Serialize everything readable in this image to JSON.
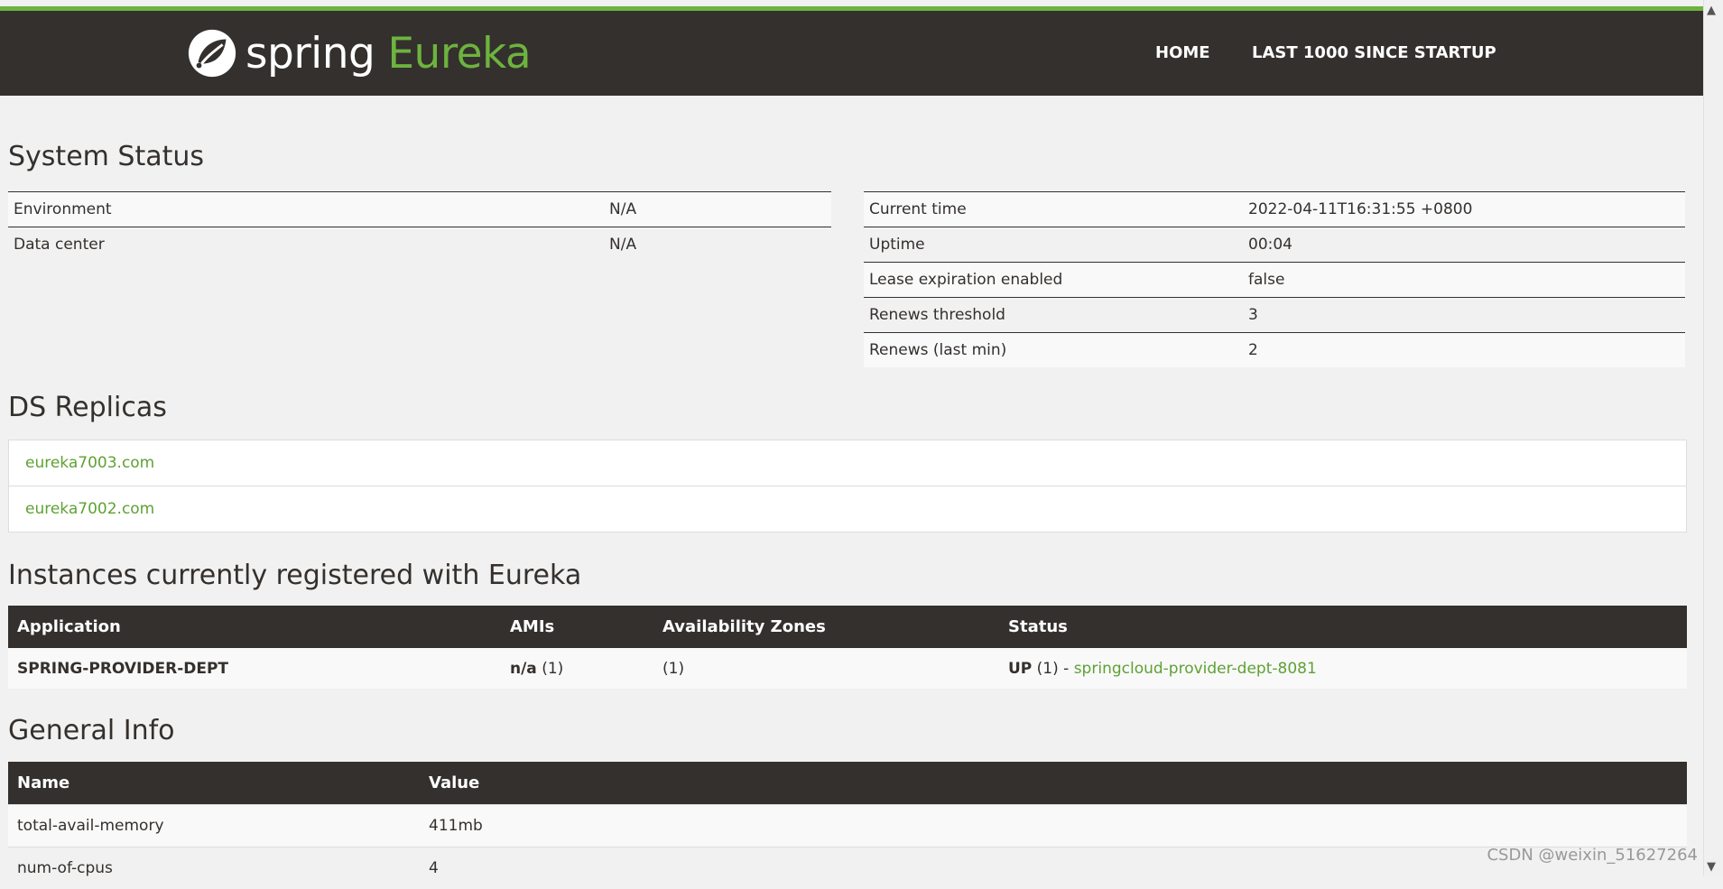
{
  "nav": {
    "brand_spring": "spring",
    "brand_eureka": "Eureka",
    "home": "HOME",
    "last1000": "LAST 1000 SINCE STARTUP"
  },
  "colors": {
    "accent": "#6db33f",
    "dark": "#34302d",
    "link": "#5fa134"
  },
  "system_status": {
    "title": "System Status",
    "left": [
      {
        "key": "Environment",
        "value": "N/A"
      },
      {
        "key": "Data center",
        "value": "N/A"
      }
    ],
    "right": [
      {
        "key": "Current time",
        "value": "2022-04-11T16:31:55 +0800"
      },
      {
        "key": "Uptime",
        "value": "00:04"
      },
      {
        "key": "Lease expiration enabled",
        "value": "false"
      },
      {
        "key": "Renews threshold",
        "value": "3"
      },
      {
        "key": "Renews (last min)",
        "value": "2"
      }
    ]
  },
  "ds_replicas": {
    "title": "DS Replicas",
    "items": [
      "eureka7003.com",
      "eureka7002.com"
    ]
  },
  "instances": {
    "title": "Instances currently registered with Eureka",
    "headers": [
      "Application",
      "AMIs",
      "Availability Zones",
      "Status"
    ],
    "rows": [
      {
        "application": "SPRING-PROVIDER-DEPT",
        "amis_bold": "n/a",
        "amis_count": " (1)",
        "zones": "(1)",
        "status_bold": "UP",
        "status_count": " (1) - ",
        "status_link": "springcloud-provider-dept-8081"
      }
    ]
  },
  "general_info": {
    "title": "General Info",
    "headers": [
      "Name",
      "Value"
    ],
    "rows": [
      {
        "name": "total-avail-memory",
        "value": "411mb"
      },
      {
        "name": "num-of-cpus",
        "value": "4"
      }
    ]
  },
  "watermark": "CSDN @weixin_51627264",
  "scrollbar": {
    "up": "▲",
    "down": "▼"
  }
}
